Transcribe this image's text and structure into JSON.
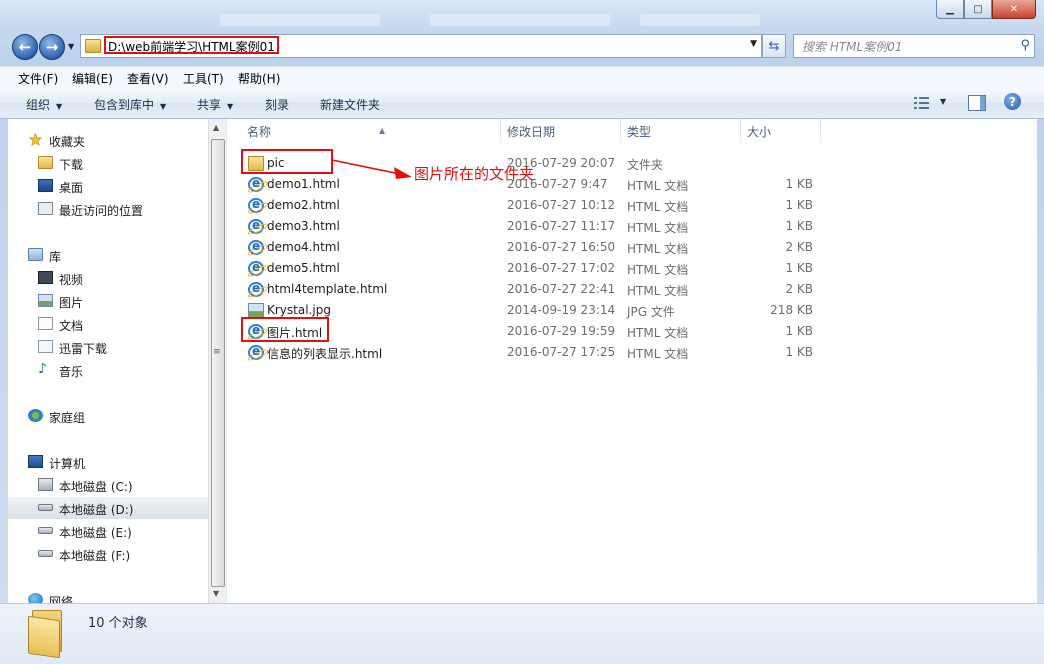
{
  "window": {
    "caption_buttons": [
      "▁",
      "□",
      "✕"
    ]
  },
  "address": {
    "path": "D:\\web前端学习\\HTML案例01",
    "search_placeholder": "搜索 HTML案例01"
  },
  "menu": [
    "文件(F)",
    "编辑(E)",
    "查看(V)",
    "工具(T)",
    "帮助(H)"
  ],
  "toolbar": {
    "organize": "组织",
    "include_in_library": "包含到库中",
    "share": "共享",
    "burn": "刻录",
    "new_folder": "新建文件夹"
  },
  "nav": {
    "favorites": {
      "label": "收藏夹",
      "icon": "star-icon"
    },
    "favorites_items": [
      {
        "label": "下载",
        "icon": "download-folder-icon"
      },
      {
        "label": "桌面",
        "icon": "desktop-icon"
      },
      {
        "label": "最近访问的位置",
        "icon": "recent-places-icon"
      }
    ],
    "libraries": {
      "label": "库",
      "icon": "library-icon"
    },
    "libraries_items": [
      {
        "label": "视频",
        "icon": "video-icon"
      },
      {
        "label": "图片",
        "icon": "pictures-icon"
      },
      {
        "label": "文档",
        "icon": "documents-icon"
      },
      {
        "label": "迅雷下载",
        "icon": "thunder-download-icon"
      },
      {
        "label": "音乐",
        "icon": "music-icon"
      }
    ],
    "homegroup": {
      "label": "家庭组",
      "icon": "homegroup-icon"
    },
    "computer": {
      "label": "计算机",
      "icon": "computer-icon"
    },
    "computer_items": [
      {
        "label": "本地磁盘 (C:)",
        "icon": "system-drive-icon"
      },
      {
        "label": "本地磁盘 (D:)",
        "icon": "drive-icon"
      },
      {
        "label": "本地磁盘 (E:)",
        "icon": "drive-icon"
      },
      {
        "label": "本地磁盘 (F:)",
        "icon": "drive-icon"
      }
    ],
    "network": {
      "label": "网络",
      "icon": "network-icon"
    }
  },
  "columns": {
    "name": "名称",
    "modified": "修改日期",
    "type": "类型",
    "size": "大小"
  },
  "files": [
    {
      "name": "pic",
      "date": "2016-07-29 20:07",
      "type": "文件夹",
      "size": "",
      "icon": "folder"
    },
    {
      "name": "demo1.html",
      "date": "2016-07-27 9:47",
      "type": "HTML 文档",
      "size": "1 KB",
      "icon": "ie"
    },
    {
      "name": "demo2.html",
      "date": "2016-07-27 10:12",
      "type": "HTML 文档",
      "size": "1 KB",
      "icon": "ie"
    },
    {
      "name": "demo3.html",
      "date": "2016-07-27 11:17",
      "type": "HTML 文档",
      "size": "1 KB",
      "icon": "ie"
    },
    {
      "name": "demo4.html",
      "date": "2016-07-27 16:50",
      "type": "HTML 文档",
      "size": "2 KB",
      "icon": "ie"
    },
    {
      "name": "demo5.html",
      "date": "2016-07-27 17:02",
      "type": "HTML 文档",
      "size": "1 KB",
      "icon": "ie"
    },
    {
      "name": "html4template.html",
      "date": "2016-07-27 22:41",
      "type": "HTML 文档",
      "size": "2 KB",
      "icon": "ie"
    },
    {
      "name": "Krystal.jpg",
      "date": "2014-09-19 23:14",
      "type": "JPG 文件",
      "size": "218 KB",
      "icon": "image"
    },
    {
      "name": "图片.html",
      "date": "2016-07-29 19:59",
      "type": "HTML 文档",
      "size": "1 KB",
      "icon": "ie"
    },
    {
      "name": "信息的列表显示.html",
      "date": "2016-07-27 17:25",
      "type": "HTML 文档",
      "size": "1 KB",
      "icon": "ie"
    }
  ],
  "annotation": {
    "text": "图片所在的文件夹",
    "color": "#e01010"
  },
  "status": {
    "count": "10 个对象"
  }
}
